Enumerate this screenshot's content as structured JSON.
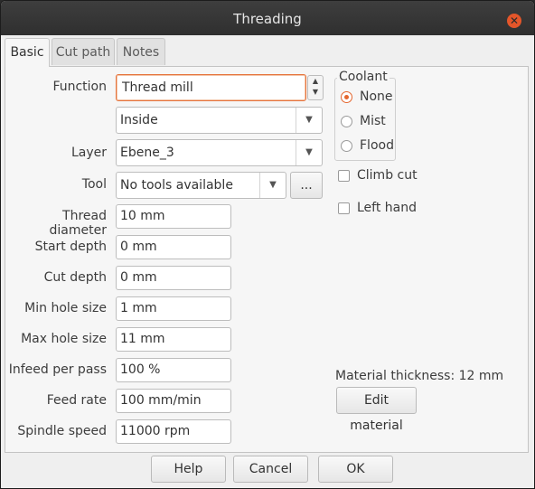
{
  "window": {
    "title": "Threading"
  },
  "tabs": [
    {
      "label": "Basic"
    },
    {
      "label": "Cut path"
    },
    {
      "label": "Notes"
    }
  ],
  "form": {
    "function_label": "Function",
    "function_value": "Thread mill",
    "side_value": "Inside",
    "layer_label": "Layer",
    "layer_value": "Ebene_3",
    "tool_label": "Tool",
    "tool_value": "No tools available",
    "tool_browse": "...",
    "thread_diameter_label": "Thread diameter",
    "thread_diameter_value": "10 mm",
    "start_depth_label": "Start depth",
    "start_depth_value": "0 mm",
    "cut_depth_label": "Cut depth",
    "cut_depth_value": "0 mm",
    "min_hole_label": "Min hole size",
    "min_hole_value": "1 mm",
    "max_hole_label": "Max hole size",
    "max_hole_value": "11 mm",
    "infeed_label": "Infeed per pass",
    "infeed_value": "100 %",
    "feed_rate_label": "Feed rate",
    "feed_rate_value": "100 mm/min",
    "spindle_label": "Spindle speed",
    "spindle_value": "11000 rpm"
  },
  "coolant": {
    "title": "Coolant",
    "options": [
      {
        "label": "None",
        "selected": true
      },
      {
        "label": "Mist",
        "selected": false
      },
      {
        "label": "Flood",
        "selected": false
      }
    ]
  },
  "options": {
    "climb_cut": "Climb cut",
    "left_hand": "Left hand"
  },
  "material": {
    "thickness_text": "Material thickness: 12 mm",
    "edit_button": "Edit material"
  },
  "buttons": {
    "help": "Help",
    "cancel": "Cancel",
    "ok": "OK"
  },
  "colors": {
    "accent": "#e4672f",
    "titlebar": "#353535"
  }
}
